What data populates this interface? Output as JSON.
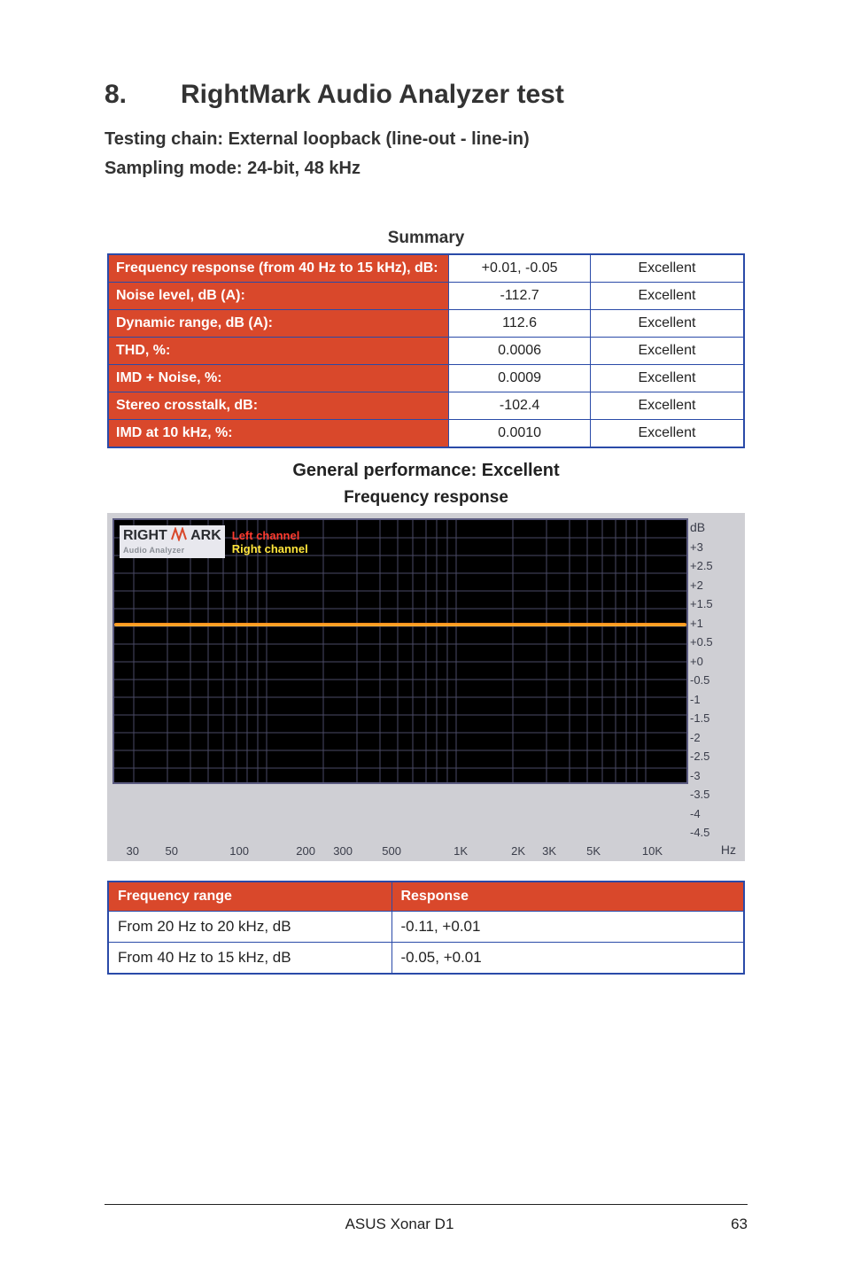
{
  "title": {
    "num": "8.",
    "text": "RightMark Audio Analyzer test"
  },
  "sub1": "Testing chain: External loopback (line-out - line-in)",
  "sub2": "Sampling mode: 24-bit, 48 kHz",
  "summary_caption": "Summary",
  "summary": [
    {
      "label": "Frequency response (from 40 Hz to 15 kHz), dB:",
      "value": "+0.01, -0.05",
      "rating": "Excellent"
    },
    {
      "label": "Noise level, dB (A):",
      "value": "-112.7",
      "rating": "Excellent"
    },
    {
      "label": "Dynamic range, dB (A):",
      "value": "112.6",
      "rating": "Excellent"
    },
    {
      "label": "THD, %:",
      "value": "0.0006",
      "rating": "Excellent"
    },
    {
      "label": "IMD + Noise, %:",
      "value": "0.0009",
      "rating": "Excellent"
    },
    {
      "label": "Stereo crosstalk, dB:",
      "value": "-102.4",
      "rating": "Excellent"
    },
    {
      "label": "IMD at 10 kHz, %:",
      "value": "0.0010",
      "rating": "Excellent"
    }
  ],
  "general_performance": "General performance: Excellent",
  "fr_title": "Frequency response",
  "chart": {
    "logo_top_left": "RIGHT",
    "logo_top_right": "ARK",
    "logo_sub": "Audio Analyzer",
    "legend_left": "Left channel",
    "legend_right": "Right channel",
    "y_unit": "dB",
    "x_unit": "Hz",
    "y_ticks": [
      "+3",
      "+2.5",
      "+2",
      "+1.5",
      "+1",
      "+0.5",
      "+0",
      "-0.5",
      "-1",
      "-1.5",
      "-2",
      "-2.5",
      "-3",
      "-3.5",
      "-4",
      "-4.5"
    ],
    "x_ticks": [
      "30",
      "50",
      "100",
      "200",
      "300",
      "500",
      "1K",
      "2K",
      "3K",
      "5K",
      "10K"
    ]
  },
  "chart_data": {
    "type": "line",
    "title": "Frequency response",
    "xlabel": "Hz",
    "ylabel": "dB",
    "ylim": [
      -4.5,
      3
    ],
    "xscale": "log",
    "series": [
      {
        "name": "Left channel",
        "x": [
          20,
          30,
          50,
          100,
          200,
          300,
          500,
          1000,
          2000,
          3000,
          5000,
          10000,
          20000
        ],
        "y": [
          -0.1,
          -0.05,
          -0.02,
          0.0,
          0.0,
          0.0,
          0.0,
          0.0,
          0.0,
          0.0,
          0.0,
          0.01,
          -0.05
        ]
      },
      {
        "name": "Right channel",
        "x": [
          20,
          30,
          50,
          100,
          200,
          300,
          500,
          1000,
          2000,
          3000,
          5000,
          10000,
          20000
        ],
        "y": [
          -0.1,
          -0.05,
          -0.02,
          0.0,
          0.0,
          0.0,
          0.0,
          0.0,
          0.0,
          0.0,
          0.0,
          0.01,
          -0.05
        ]
      }
    ]
  },
  "freq_table": {
    "head": [
      "Frequency range",
      "Response"
    ],
    "rows": [
      [
        "From 20 Hz to 20 kHz, dB",
        "-0.11, +0.01"
      ],
      [
        "From 40 Hz to 15 kHz, dB",
        "-0.05, +0.01"
      ]
    ]
  },
  "footer": {
    "product": "ASUS Xonar D1",
    "page": "63"
  }
}
